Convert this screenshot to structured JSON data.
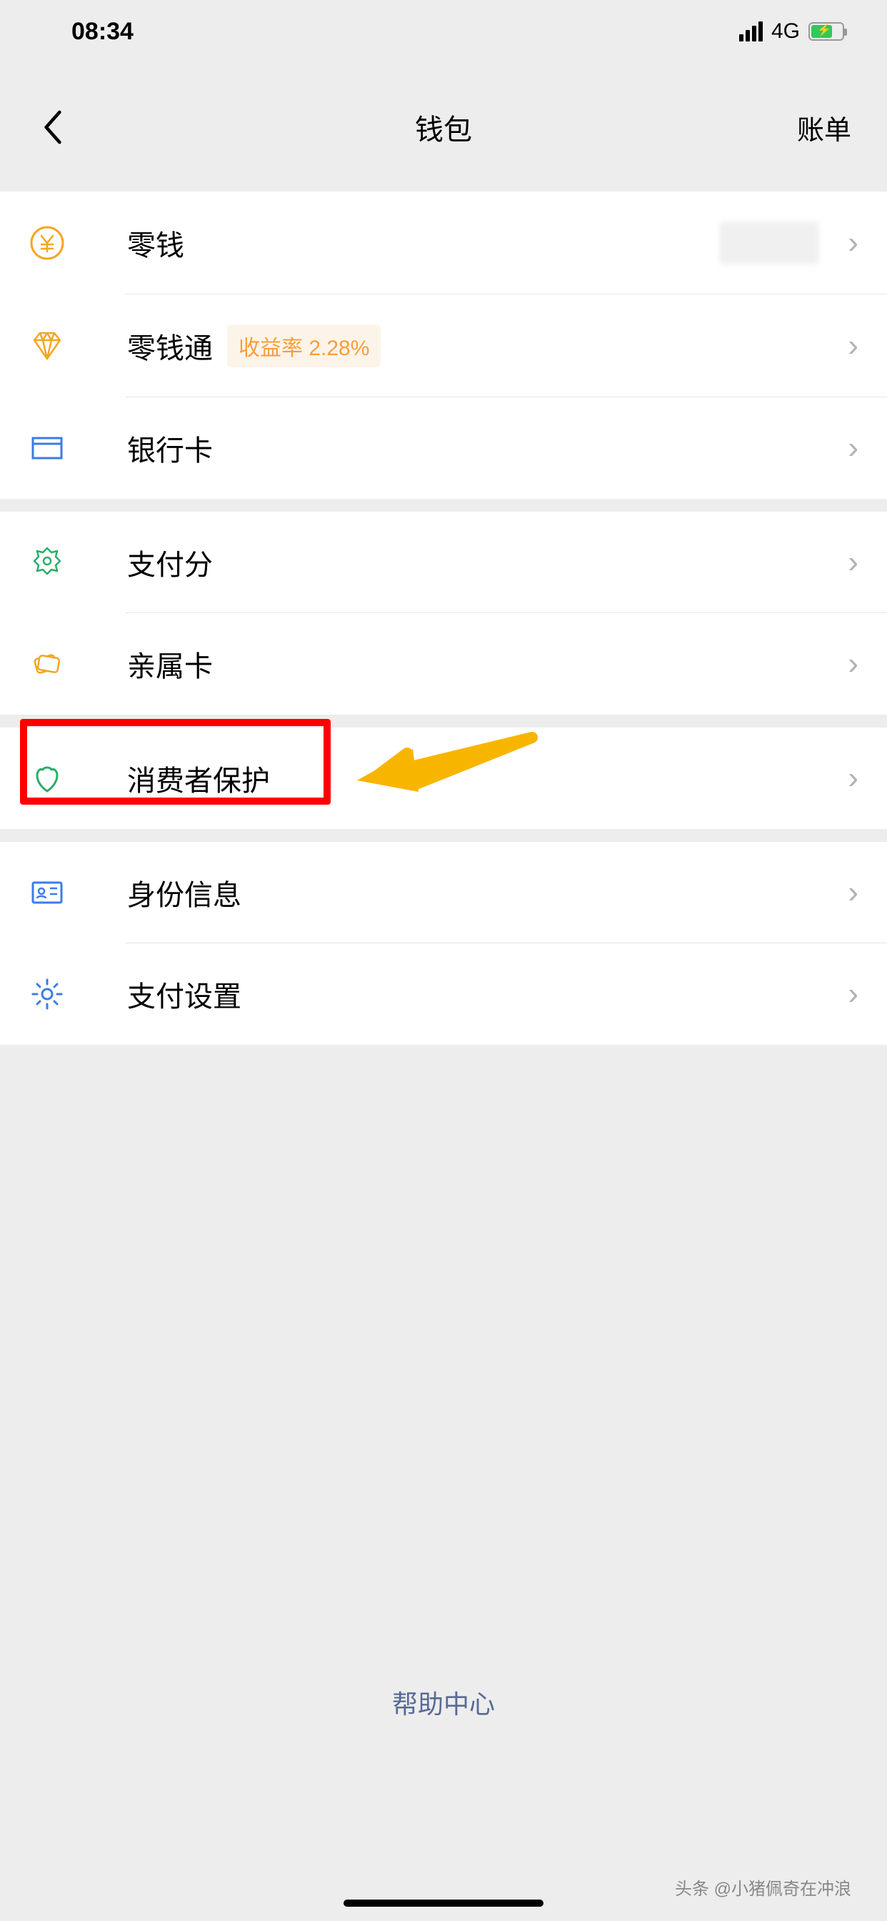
{
  "status_bar": {
    "time": "08:34",
    "network_type": "4G"
  },
  "nav": {
    "title": "钱包",
    "right_action": "账单"
  },
  "groups": [
    {
      "rows": [
        {
          "icon": "yen-circle",
          "label": "零钱",
          "value_blurred": true
        },
        {
          "icon": "diamond",
          "label": "零钱通",
          "badge": "收益率 2.28%"
        },
        {
          "icon": "card",
          "label": "银行卡"
        }
      ]
    },
    {
      "rows": [
        {
          "icon": "badge-star",
          "label": "支付分"
        },
        {
          "icon": "cards-stack",
          "label": "亲属卡"
        }
      ]
    },
    {
      "rows": [
        {
          "icon": "hands-shield",
          "label": "消费者保护",
          "highlight": true
        }
      ]
    },
    {
      "rows": [
        {
          "icon": "id-card",
          "label": "身份信息"
        },
        {
          "icon": "gear",
          "label": "支付设置"
        }
      ]
    }
  ],
  "help_center": "帮助中心",
  "footer_attribution": "头条 @小猪佩奇在冲浪"
}
